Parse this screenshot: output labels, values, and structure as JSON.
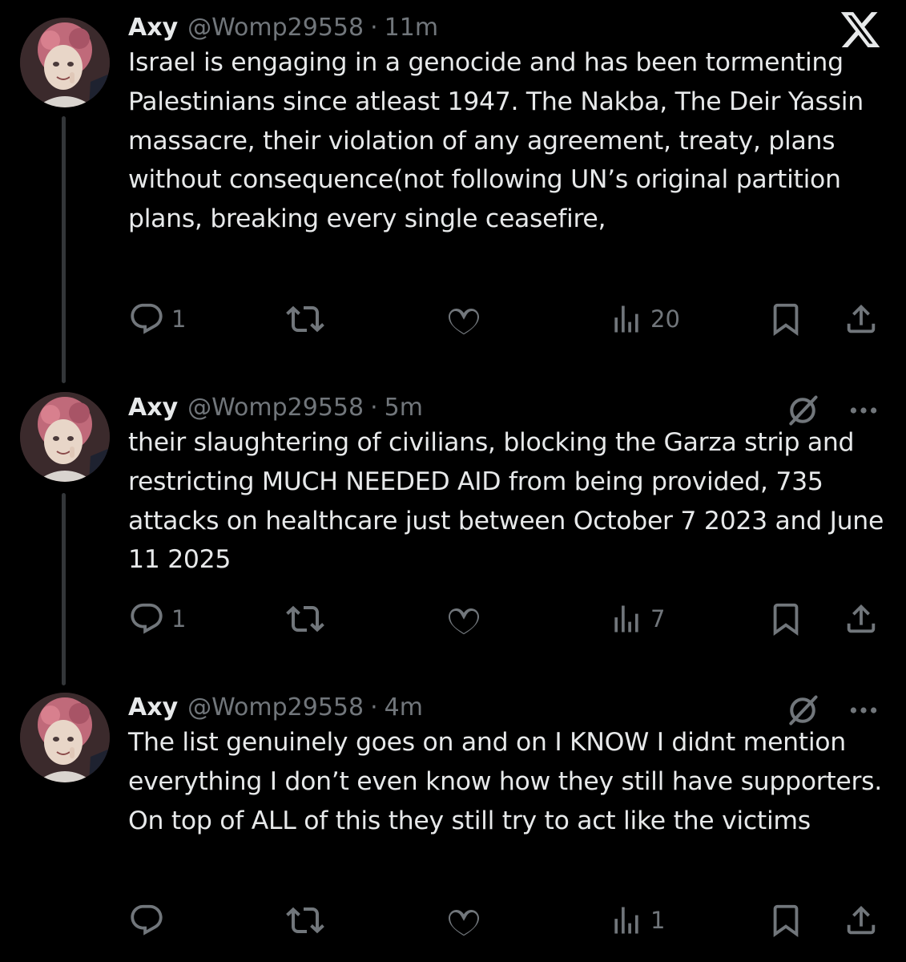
{
  "brand": {
    "logo_icon": "x-logo-icon",
    "logo_color": "#e7e9ea"
  },
  "colors": {
    "background": "#000000",
    "primary_text": "#e7e9ea",
    "secondary_text": "#71767b",
    "thread_line": "#333639"
  },
  "tweets": [
    {
      "name": "Axy",
      "handle": "@Womp29558",
      "separator": "·",
      "time": "11m",
      "text": "Israel is engaging in a genocide and has been tormenting Palestinians since atleast 1947. The Nakba, The Deir Yassin massacre, their violation of any agreement, treaty, plans without consequence(not following UN’s original partition plans, breaking every single ceasefire,",
      "replies": "1",
      "views": "20"
    },
    {
      "name": "Axy",
      "handle": "@Womp29558",
      "separator": "·",
      "time": "5m",
      "text": "their slaughtering of civilians, blocking the Garza strip and restricting MUCH NEEDED AID from being provided, 735 attacks on healthcare just between October 7 2023 and June 11 2025",
      "replies": "1",
      "views": "7"
    },
    {
      "name": "Axy",
      "handle": "@Womp29558",
      "separator": "·",
      "time": "4m",
      "text": "The list genuinely goes on and on I KNOW I didnt mention everything I don’t even know how they still have supporters. On top of ALL of this they still try to act like the victims",
      "replies": "",
      "views": "1"
    }
  ]
}
